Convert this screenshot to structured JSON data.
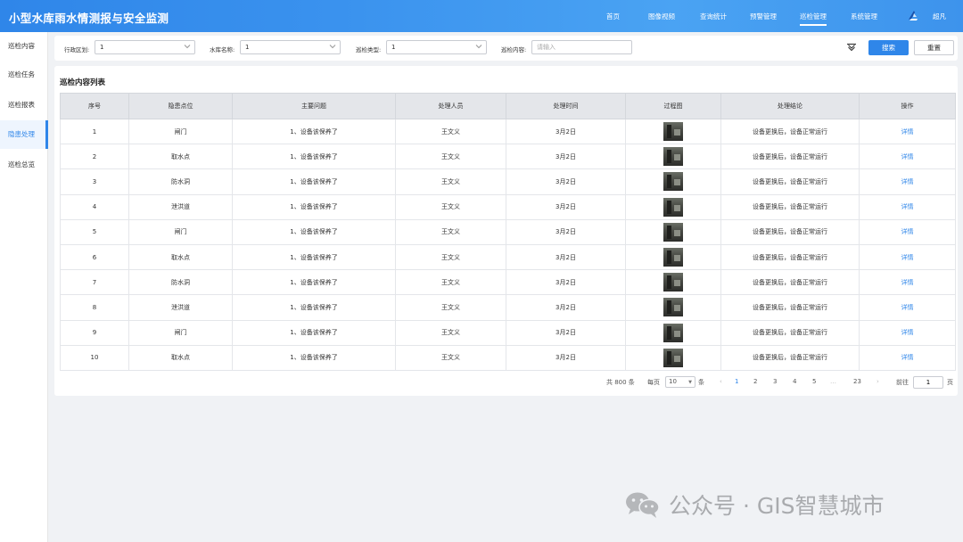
{
  "header": {
    "app_title": "小型水库雨水情测报与安全监测",
    "nav": [
      "首页",
      "图像视频",
      "查询统计",
      "预警管理",
      "巡检管理",
      "系统管理"
    ],
    "active_nav": "巡检管理",
    "user_name": "超凡"
  },
  "sidebar": {
    "items": [
      "巡检内容",
      "巡检任务",
      "巡检报表",
      "隐患处理",
      "巡检总览"
    ],
    "active_item": "隐患处理"
  },
  "filters": {
    "district_label": "行政区划:",
    "district_value": "1",
    "reservoir_label": "水库名称:",
    "reservoir_value": "1",
    "type_label": "巡检类型:",
    "type_value": "1",
    "content_label": "巡检内容:",
    "content_placeholder": "请输入",
    "search_label": "搜索",
    "reset_label": "重置"
  },
  "table": {
    "title": "巡检内容列表",
    "columns": [
      "序号",
      "隐患点位",
      "主要问题",
      "处理人员",
      "处理时间",
      "过程图",
      "处理结论",
      "操作"
    ],
    "rows": [
      {
        "no": "1",
        "point": "闸门",
        "problem": "1、设备该保养了",
        "handler": "王文义",
        "time": "3月2日",
        "conclusion": "设备更换后，设备正常运行",
        "action": "详情"
      },
      {
        "no": "2",
        "point": "取水点",
        "problem": "1、设备该保养了",
        "handler": "王文义",
        "time": "3月2日",
        "conclusion": "设备更换后，设备正常运行",
        "action": "详情"
      },
      {
        "no": "3",
        "point": "防水洞",
        "problem": "1、设备该保养了",
        "handler": "王文义",
        "time": "3月2日",
        "conclusion": "设备更换后，设备正常运行",
        "action": "详情"
      },
      {
        "no": "4",
        "point": "泄洪道",
        "problem": "1、设备该保养了",
        "handler": "王文义",
        "time": "3月2日",
        "conclusion": "设备更换后，设备正常运行",
        "action": "详情"
      },
      {
        "no": "5",
        "point": "闸门",
        "problem": "1、设备该保养了",
        "handler": "王文义",
        "time": "3月2日",
        "conclusion": "设备更换后，设备正常运行",
        "action": "详情"
      },
      {
        "no": "6",
        "point": "取水点",
        "problem": "1、设备该保养了",
        "handler": "王文义",
        "time": "3月2日",
        "conclusion": "设备更换后，设备正常运行",
        "action": "详情"
      },
      {
        "no": "7",
        "point": "防水洞",
        "problem": "1、设备该保养了",
        "handler": "王文义",
        "time": "3月2日",
        "conclusion": "设备更换后，设备正常运行",
        "action": "详情"
      },
      {
        "no": "8",
        "point": "泄洪道",
        "problem": "1、设备该保养了",
        "handler": "王文义",
        "time": "3月2日",
        "conclusion": "设备更换后，设备正常运行",
        "action": "详情"
      },
      {
        "no": "9",
        "point": "闸门",
        "problem": "1、设备该保养了",
        "handler": "王文义",
        "time": "3月2日",
        "conclusion": "设备更换后，设备正常运行",
        "action": "详情"
      },
      {
        "no": "10",
        "point": "取水点",
        "problem": "1、设备该保养了",
        "handler": "王文义",
        "time": "3月2日",
        "conclusion": "设备更换后，设备正常运行",
        "action": "详情"
      }
    ]
  },
  "pagination": {
    "total_text": "共 800 条",
    "per_page_label": "每页",
    "page_size": "10",
    "unit_label": "条",
    "prev_symbol": "‹",
    "pages": [
      "1",
      "2",
      "3",
      "4",
      "5"
    ],
    "current_page": "1",
    "ellipsis": "…",
    "last_page": "23",
    "next_symbol": "›",
    "goto_label": "前往",
    "goto_value": "1",
    "page_unit": "页"
  },
  "watermark": {
    "text": "公众号 · GIS智慧城市"
  },
  "colors": {
    "primary": "#2f86e9",
    "header_gradient_start": "#2f86e9",
    "header_gradient_end": "#4aa3f3",
    "table_header_bg": "#e4e6ea",
    "page_bg": "#f0f2f5"
  },
  "icons": {
    "user": "user-logo-icon",
    "collapse": "collapse-filter-icon",
    "dropdown": "chevron-down-icon",
    "watermark": "wechat-icon"
  }
}
